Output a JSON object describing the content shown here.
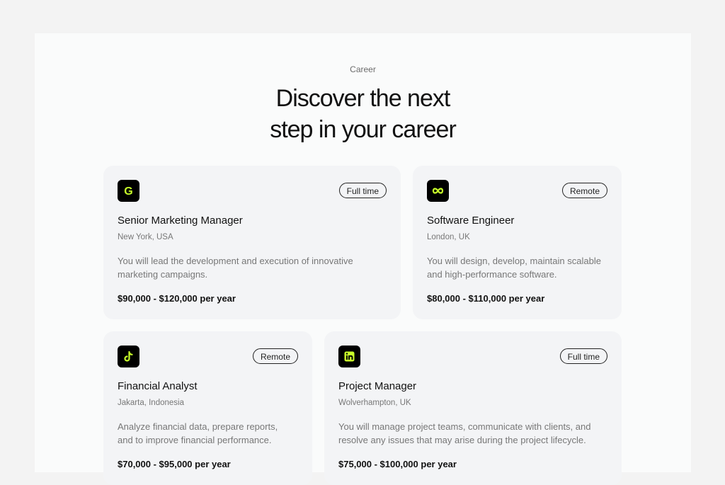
{
  "header": {
    "eyebrow": "Career",
    "headline_line1": "Discover the next",
    "headline_line2": "step in your career"
  },
  "brand": {
    "accent": "#c8ff2a",
    "logo_bg": "#000000"
  },
  "jobs": [
    {
      "logo_icon": "g-logo-icon",
      "tag": "Full time",
      "title": "Senior Marketing Manager",
      "location": "New York, USA",
      "description": "You will lead the development and execution of innovative marketing campaigns.",
      "salary": "$90,000 - $120,000 per year"
    },
    {
      "logo_icon": "infinity-logo-icon",
      "tag": "Remote",
      "title": "Software Engineer",
      "location": "London, UK",
      "description": "You will design, develop, maintain scalable and high-performance software.",
      "salary": "$80,000 - $110,000 per year"
    },
    {
      "logo_icon": "tiktok-logo-icon",
      "tag": "Remote",
      "title": "Financial Analyst",
      "location": "Jakarta, Indonesia",
      "description": "Analyze financial data, prepare reports, and to improve financial performance.",
      "salary": "$70,000 - $95,000 per year"
    },
    {
      "logo_icon": "linkedin-logo-icon",
      "tag": "Full time",
      "title": "Project Manager",
      "location": "Wolverhampton, UK",
      "description": "You will manage project teams, communicate with clients, and resolve any issues that may arise during the project lifecycle.",
      "salary": "$75,000 - $100,000 per year"
    }
  ]
}
